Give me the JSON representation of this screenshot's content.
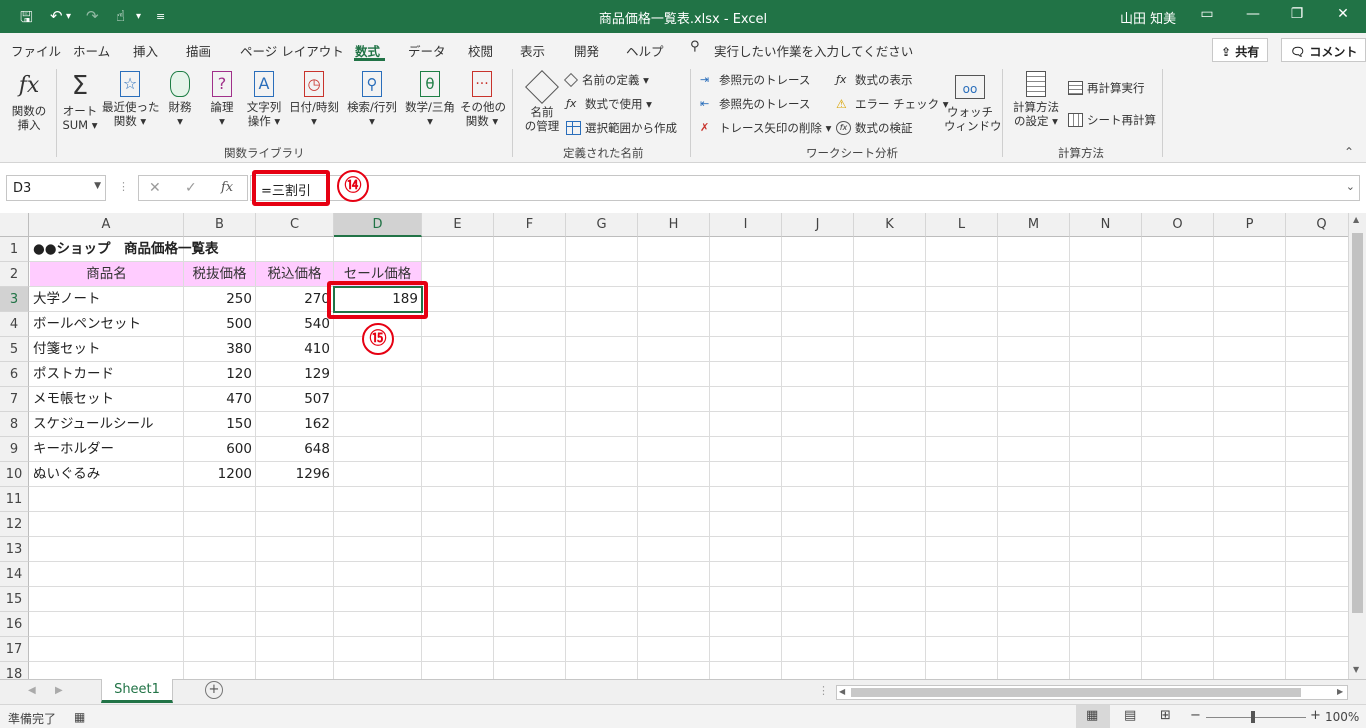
{
  "window": {
    "title": "商品価格一覧表.xlsx - Excel",
    "user": "山田 知美"
  },
  "tabs": [
    "ファイル",
    "ホーム",
    "挿入",
    "描画",
    "ページ レイアウト",
    "数式",
    "データ",
    "校閲",
    "表示",
    "開発",
    "ヘルプ"
  ],
  "tell_me": "実行したい作業を入力してください",
  "share_label": "共有",
  "comment_label": "コメント",
  "ribbon": {
    "insert_fn": [
      "関数の",
      "挿入"
    ],
    "autosum": [
      "オート",
      "SUM ▾"
    ],
    "recent": [
      "最近使った",
      "関数 ▾"
    ],
    "financial": [
      "財務",
      "▾"
    ],
    "logical": [
      "論理",
      "▾"
    ],
    "text": [
      "文字列",
      "操作 ▾"
    ],
    "datetime": [
      "日付/時刻",
      "▾"
    ],
    "lookup": [
      "検索/行列",
      "▾"
    ],
    "math": [
      "数学/三角",
      "▾"
    ],
    "more": [
      "その他の",
      "関数 ▾"
    ],
    "group_library": "関数ライブラリ",
    "name_mgr": [
      "名前",
      "の管理"
    ],
    "define_name": "名前の定義 ▾",
    "use_in_formula": "数式で使用 ▾",
    "create_from_sel": "選択範囲から作成",
    "group_names": "定義された名前",
    "trace_prec": "参照元のトレース",
    "trace_dep": "参照先のトレース",
    "remove_arrows": "トレース矢印の削除 ▾",
    "show_formulas": "数式の表示",
    "error_check": "エラー チェック ▾",
    "evaluate": "数式の検証",
    "watch": [
      "ウォッチ",
      "ウィンドウ"
    ],
    "group_audit": "ワークシート分析",
    "calc_options": [
      "計算方法",
      "の設定 ▾"
    ],
    "calc_now": "再計算実行",
    "calc_sheet": "シート再計算",
    "group_calc": "計算方法"
  },
  "formula_bar": {
    "name_box": "D3",
    "formula": "=三割引"
  },
  "callouts": {
    "c14": "⑭",
    "c15": "⑮"
  },
  "columns": [
    "A",
    "B",
    "C",
    "D",
    "E",
    "F",
    "G",
    "H",
    "I",
    "J",
    "K",
    "L",
    "M",
    "N",
    "O",
    "P",
    "Q"
  ],
  "rows": [
    "1",
    "2",
    "3",
    "4",
    "5",
    "6",
    "7",
    "8",
    "9",
    "10",
    "11",
    "12",
    "13",
    "14",
    "15",
    "16",
    "17",
    "18"
  ],
  "sheet": {
    "title": "●●ショップ　商品価格一覧表",
    "headers": [
      "商品名",
      "税抜価格",
      "税込価格",
      "セール価格"
    ],
    "items": [
      {
        "name": "大学ノート",
        "pre": "250",
        "tax": "270",
        "sale": "189"
      },
      {
        "name": "ボールペンセット",
        "pre": "500",
        "tax": "540",
        "sale": ""
      },
      {
        "name": "付箋セット",
        "pre": "380",
        "tax": "410",
        "sale": ""
      },
      {
        "name": "ポストカード",
        "pre": "120",
        "tax": "129",
        "sale": ""
      },
      {
        "name": "メモ帳セット",
        "pre": "470",
        "tax": "507",
        "sale": ""
      },
      {
        "name": "スケジュールシール",
        "pre": "150",
        "tax": "162",
        "sale": ""
      },
      {
        "name": "キーホルダー",
        "pre": "600",
        "tax": "648",
        "sale": ""
      },
      {
        "name": "ぬいぐるみ",
        "pre": "1200",
        "tax": "1296",
        "sale": ""
      }
    ]
  },
  "sheet_tab": "Sheet1",
  "status": {
    "ready": "準備完了",
    "zoom": "100%"
  },
  "colors": {
    "accent": "#217346",
    "callout": "#e60012",
    "header_fill": "#ffccff"
  }
}
